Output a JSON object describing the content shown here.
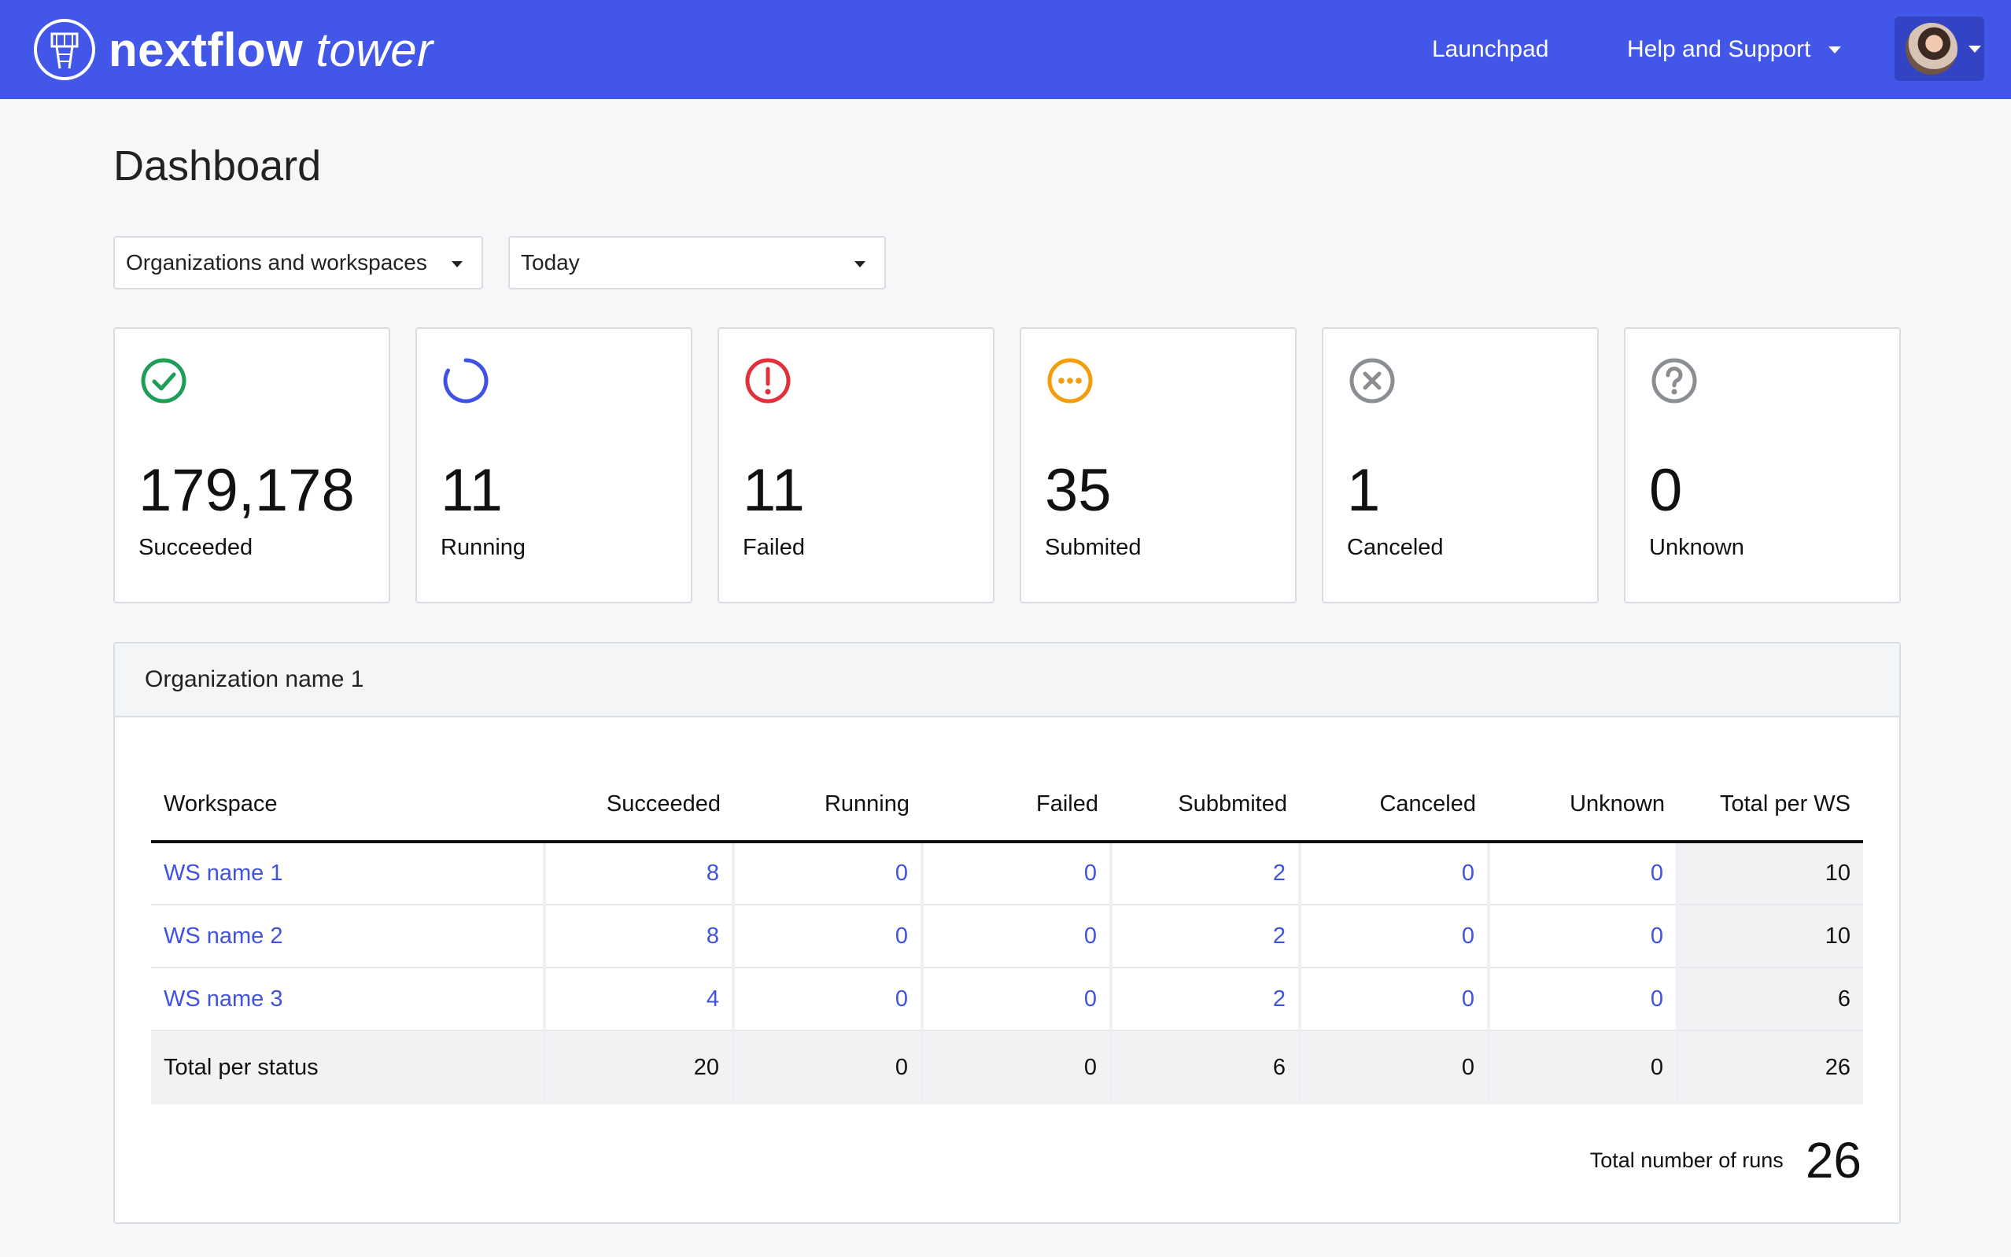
{
  "header": {
    "brand_bold": "nextflow",
    "brand_light": "tower",
    "launchpad": "Launchpad",
    "help": "Help and Support"
  },
  "page": {
    "title": "Dashboard"
  },
  "filters": {
    "scope": "Organizations and workspaces",
    "period": "Today"
  },
  "stats": [
    {
      "label": "Succeeded",
      "value": "179,178",
      "icon": "check-circle-icon",
      "color": "#1e9e56"
    },
    {
      "label": "Running",
      "value": "11",
      "icon": "spinner-icon",
      "color": "#3f52e3"
    },
    {
      "label": "Failed",
      "value": "11",
      "icon": "alert-circle-icon",
      "color": "#e0303a"
    },
    {
      "label": "Submited",
      "value": "35",
      "icon": "dots-circle-icon",
      "color": "#f49e0b"
    },
    {
      "label": "Canceled",
      "value": "1",
      "icon": "x-circle-icon",
      "color": "#8a8d91"
    },
    {
      "label": "Unknown",
      "value": "0",
      "icon": "question-circle-icon",
      "color": "#8a8d91"
    }
  ],
  "org": {
    "name": "Organization name 1",
    "columns": [
      "Workspace",
      "Succeeded",
      "Running",
      "Failed",
      "Subbmited",
      "Canceled",
      "Unknown",
      "Total per WS"
    ],
    "rows": [
      {
        "name": "WS name 1",
        "cells": [
          "8",
          "0",
          "0",
          "2",
          "0",
          "0"
        ],
        "total": "10"
      },
      {
        "name": "WS name 2",
        "cells": [
          "8",
          "0",
          "0",
          "2",
          "0",
          "0"
        ],
        "total": "10"
      },
      {
        "name": "WS name 3",
        "cells": [
          "4",
          "0",
          "0",
          "2",
          "0",
          "0"
        ],
        "total": "6"
      }
    ],
    "totals_label": "Total per status",
    "totals": [
      "20",
      "0",
      "0",
      "6",
      "0",
      "0"
    ],
    "grand_total": "26",
    "total_runs_label": "Total number of runs",
    "total_runs": "26"
  }
}
